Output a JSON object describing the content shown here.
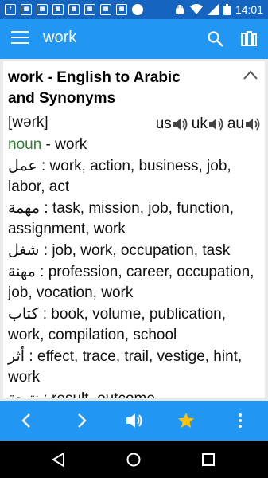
{
  "status_bar": {
    "time": "14:01",
    "icon_names": [
      "f-icon",
      "news-icon",
      "news-icon",
      "news-icon",
      "news-icon",
      "news-icon",
      "news-icon",
      "news-icon",
      "circle-icon",
      "android-icon",
      "wifi-icon",
      "signal-icon",
      "battery-icon"
    ]
  },
  "app_bar": {
    "title": "work"
  },
  "entry": {
    "heading_line1": "work - English to Arabic",
    "heading_line2": "and Synonyms",
    "ipa": "[wərk]",
    "audio": [
      "us",
      "uk",
      "au"
    ],
    "pos": "noun",
    "pos_word": " - work",
    "senses": [
      {
        "ar": "عمل",
        "syn": " : work, action, business, job, labor, act"
      },
      {
        "ar": "مهمة",
        "syn": " : task, mission, job, function, assignment, work"
      },
      {
        "ar": "شغل",
        "syn": " : job, work, occupation, task"
      },
      {
        "ar": "مهنة",
        "syn": " : profession, career, occupation, job, vocation, work"
      },
      {
        "ar": "كتاب",
        "syn": " : book, volume, publication, work, compilation, school"
      },
      {
        "ar": "أثر",
        "syn": " : effect, trace, trail, vestige, hint, work"
      },
      {
        "ar": "نتيجة",
        "syn": " : result, outcome,"
      }
    ]
  },
  "colors": {
    "primary": "#2196f3",
    "primary_dark": "#1565c0",
    "pos_green": "#2e7d32",
    "star": "#ffc107"
  },
  "bottom_bar": {
    "icon_names": [
      "chevron-left-icon",
      "chevron-right-icon",
      "speaker-icon",
      "star-icon",
      "more-vert-icon"
    ]
  },
  "nav_bar": {
    "icon_names": [
      "back-icon",
      "home-icon",
      "recents-icon"
    ]
  }
}
